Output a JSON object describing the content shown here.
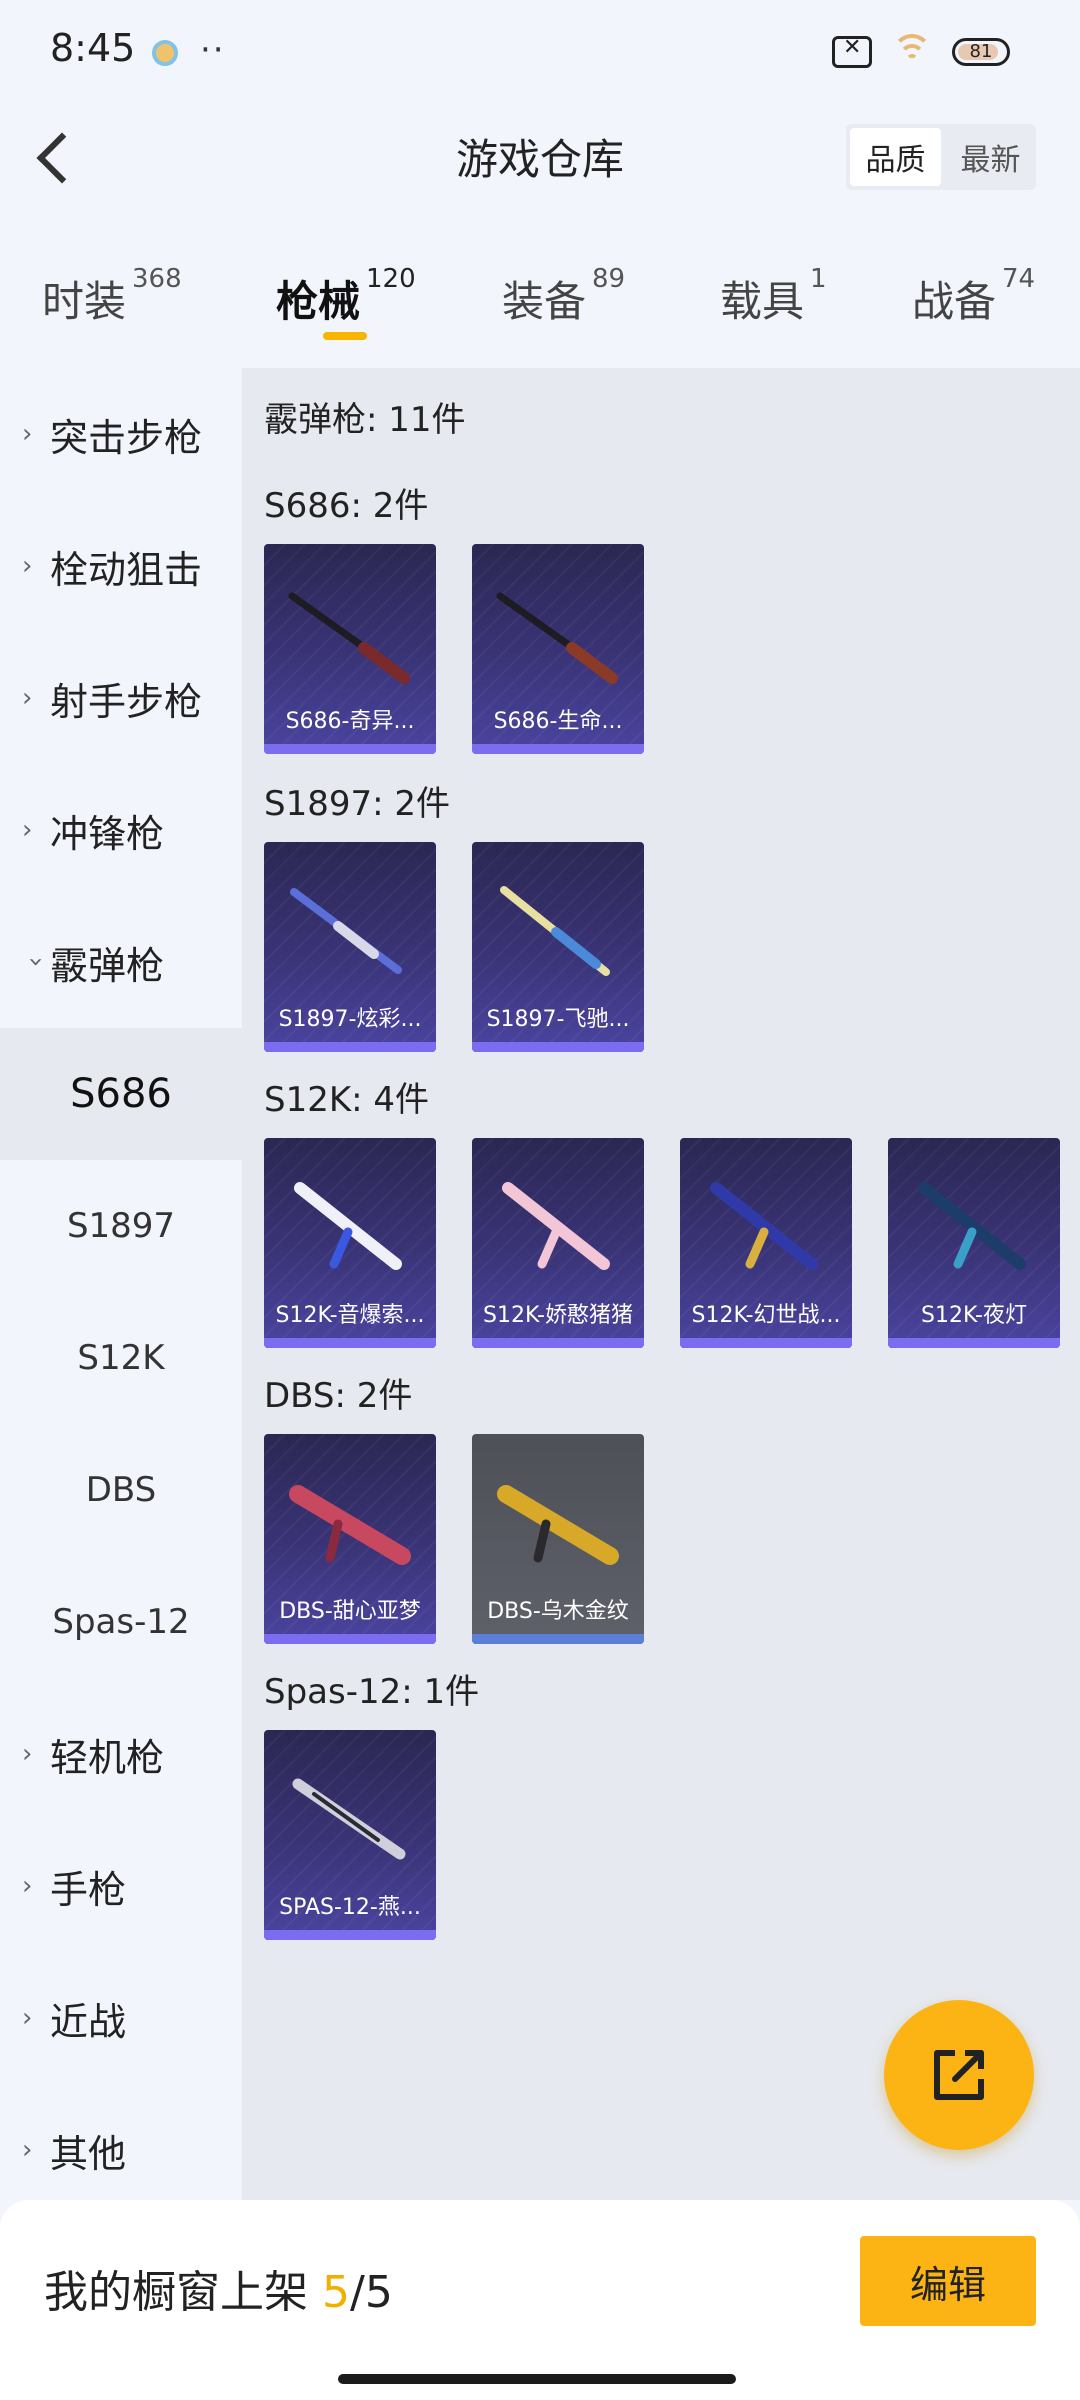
{
  "status_bar": {
    "time": "8:45",
    "dots": "··",
    "battery": "81"
  },
  "header": {
    "title": "游戏仓库",
    "sort_options": [
      "品质",
      "最新"
    ]
  },
  "tabs": [
    {
      "label": "时装",
      "count": "368"
    },
    {
      "label": "枪械",
      "count": "120"
    },
    {
      "label": "装备",
      "count": "89"
    },
    {
      "label": "载具",
      "count": "1"
    },
    {
      "label": "战备",
      "count": "74"
    }
  ],
  "sidebar": {
    "categories": [
      "突击步枪",
      "栓动狙击",
      "射手步枪",
      "冲锋枪",
      "霰弹枪"
    ],
    "subcategories": [
      "S686",
      "S1897",
      "S12K",
      "DBS",
      "Spas-12"
    ],
    "categories_after": [
      "轻机枪",
      "手枪",
      "近战",
      "其他"
    ]
  },
  "content": {
    "category_title": "霰弹枪: 11件",
    "groups": [
      {
        "title": "S686: 2件",
        "items": [
          "S686-奇异...",
          "S686-生命..."
        ]
      },
      {
        "title": "S1897: 2件",
        "items": [
          "S1897-炫彩...",
          "S1897-飞驰..."
        ]
      },
      {
        "title": "S12K: 4件",
        "items": [
          "S12K-音爆索...",
          "S12K-娇憨猪猪",
          "S12K-幻世战...",
          "S12K-夜灯"
        ]
      },
      {
        "title": "DBS: 2件",
        "items": [
          "DBS-甜心亚梦",
          "DBS-乌木金纹"
        ]
      },
      {
        "title": "Spas-12: 1件",
        "items": [
          "SPAS-12-燕..."
        ]
      }
    ]
  },
  "bottom_bar": {
    "label": "我的橱窗上架",
    "shown": "5",
    "total": "/5",
    "edit_label": "编辑"
  },
  "colors": {
    "accent": "#fbb414",
    "card_purple": "#3a3478",
    "card_grey": "#5f616a"
  }
}
